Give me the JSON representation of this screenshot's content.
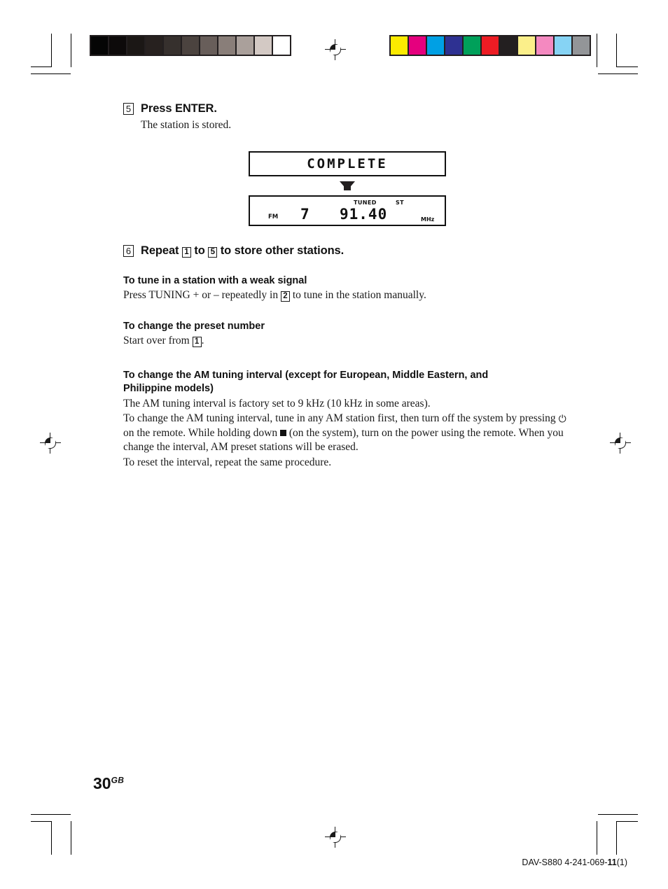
{
  "page": {
    "number": "30",
    "number_suffix": "GB",
    "model_code_prefix": "DAV-S880 4-241-069-",
    "model_code_bold": "11",
    "model_code_suffix": "(1)"
  },
  "steps": [
    {
      "number": "5",
      "title": "Press ENTER.",
      "body": "The station is stored."
    },
    {
      "number": "6",
      "title_part1": "Repeat",
      "ref_from": "1",
      "title_part2": "to",
      "ref_to": "5",
      "title_part3": "to store other stations."
    }
  ],
  "displays": {
    "complete": {
      "text": "COMPLETE"
    },
    "tuner": {
      "indicator_tuned": "TUNED",
      "indicator_stereo": "ST",
      "band": "FM",
      "preset": "7",
      "frequency": "91.40",
      "unit": "MHz"
    }
  },
  "sections": [
    {
      "heading": "To tune in a station with a weak signal",
      "body_part1": "Press TUNING + or – repeatedly in",
      "ref": "2",
      "body_part2": "to tune in the station manually."
    },
    {
      "heading": "To change the preset number",
      "body_part1": "Start over from",
      "ref": "1",
      "body_part2": "."
    },
    {
      "heading_line1": "To change the AM tuning interval (except for European, Middle Eastern, and",
      "heading_line2": "Philippine models)",
      "para1": "The AM tuning interval is factory set to 9 kHz (10 kHz in some areas).",
      "para2_part1": "To change the AM tuning interval, tune in any AM station first, then turn off the system by pressing",
      "power_symbol": "⏻",
      "para2_part2": "on the remote. While holding down",
      "para2_part3": "(on the system), turn on the power using the remote. When you change the interval, AM preset stations will be erased.",
      "para3": "To reset the interval, repeat the same procedure."
    }
  ],
  "calibration": {
    "grayscale_label": "grayscale-step-wedge",
    "grayscale_swatches": [
      "#050505",
      "#0d0a0a",
      "#1b1715",
      "#27211f",
      "#36302d",
      "#4b433f",
      "#685e5a",
      "#897e79",
      "#aaa09b",
      "#d3c9c4",
      "#ffffff"
    ],
    "color_label": "color-control-bar",
    "color_swatches": [
      "#fcea00",
      "#e5007e",
      "#00a0e4",
      "#2e3192",
      "#00a05a",
      "#ed1c24",
      "#231f20",
      "#fbef8a",
      "#f489c0",
      "#86d3f4",
      "#939598"
    ]
  }
}
